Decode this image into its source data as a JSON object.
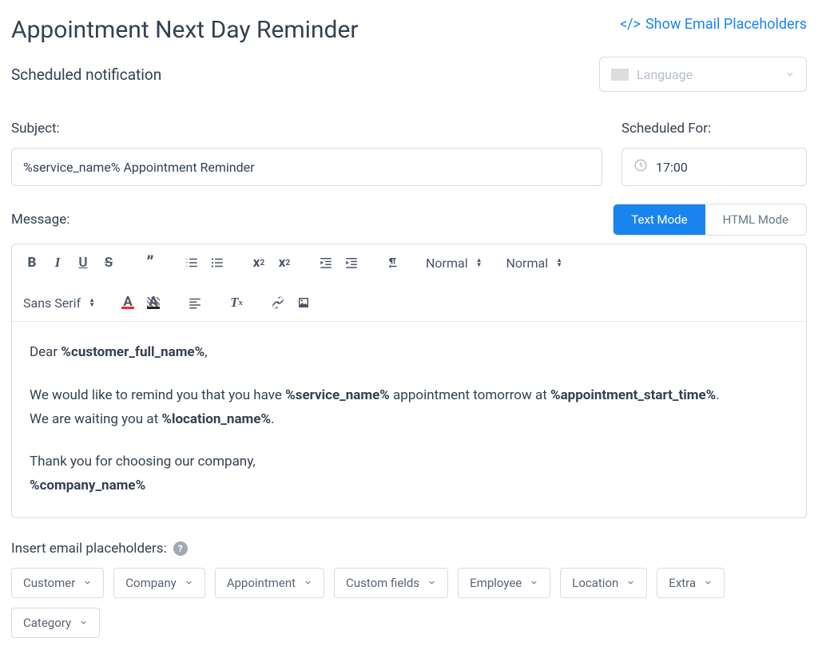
{
  "header": {
    "title": "Appointment Next Day Reminder",
    "show_placeholders_link": "Show Email Placeholders",
    "subtitle": "Scheduled notification"
  },
  "language": {
    "placeholder": "Language"
  },
  "subject": {
    "label": "Subject:",
    "value": "%service_name% Appointment Reminder"
  },
  "scheduled": {
    "label": "Scheduled For:",
    "value": "17:00"
  },
  "message": {
    "label": "Message:"
  },
  "modes": {
    "text": "Text Mode",
    "html": "HTML Mode"
  },
  "toolbar": {
    "heading_normal": "Normal",
    "size_normal": "Normal",
    "font_family": "Sans Serif"
  },
  "body": {
    "greeting_prefix": "Dear ",
    "greeting_bold": "%customer_full_name%",
    "greeting_suffix": ",",
    "line2_a": "We would like to remind you that you have ",
    "line2_b": "%service_name%",
    "line2_c": " appointment tomorrow at ",
    "line2_d": "%appointment_start_time%",
    "line2_e": ".",
    "line3_a": "We are waiting you at ",
    "line3_b": "%location_name%",
    "line3_c": ".",
    "line4": "Thank you for choosing our company,",
    "line5": "%company_name%"
  },
  "insert": {
    "label": "Insert email placeholders:",
    "chips": [
      "Customer",
      "Company",
      "Appointment",
      "Custom fields",
      "Employee",
      "Location",
      "Extra",
      "Category"
    ]
  }
}
